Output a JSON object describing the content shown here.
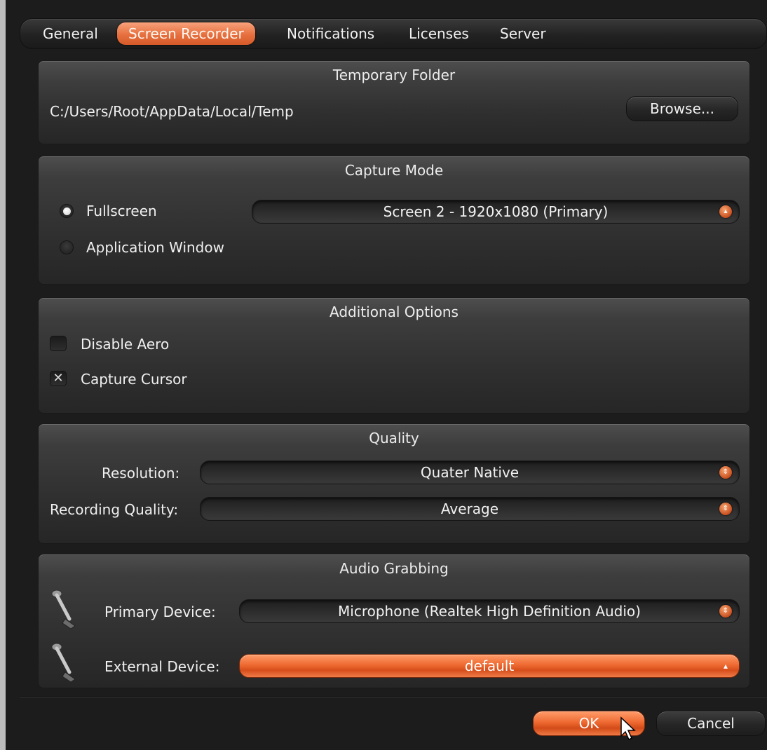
{
  "tabs": [
    {
      "label": "General"
    },
    {
      "label": "Screen Recorder"
    },
    {
      "label": "Notifications"
    },
    {
      "label": "Licenses"
    },
    {
      "label": "Server"
    }
  ],
  "active_tab": "Screen Recorder",
  "temp_folder": {
    "title": "Temporary Folder",
    "path": "C:/Users/Root/AppData/Local/Temp",
    "browse_label": "Browse..."
  },
  "capture_mode": {
    "title": "Capture Mode",
    "fullscreen_label": "Fullscreen",
    "fullscreen_selected": true,
    "app_window_label": "Application Window",
    "screen_select_value": "Screen 2 - 1920x1080 (Primary)"
  },
  "additional_options": {
    "title": "Additional Options",
    "disable_aero_label": "Disable Aero",
    "disable_aero_checked": false,
    "capture_cursor_label": "Capture Cursor",
    "capture_cursor_checked": true,
    "check_mark": "✕"
  },
  "quality": {
    "title": "Quality",
    "resolution_label": "Resolution:",
    "resolution_value": "Quater Native",
    "recording_quality_label": "Recording Quality:",
    "recording_quality_value": "Average"
  },
  "audio": {
    "title": "Audio Grabbing",
    "primary_label": "Primary Device:",
    "primary_value": "Microphone (Realtek High Definition Audio)",
    "external_label": "External Device:",
    "external_value": "default"
  },
  "footer": {
    "ok_label": "OK",
    "cancel_label": "Cancel"
  },
  "colors": {
    "accent": "#ef6a32",
    "panel": "#3a3a3a",
    "background": "#1c1c1c"
  },
  "icons": {
    "combo_arrow": "▾",
    "combo_arrow_up": "▴",
    "microphone": "microphone-icon",
    "cursor": "mouse-cursor-icon"
  }
}
